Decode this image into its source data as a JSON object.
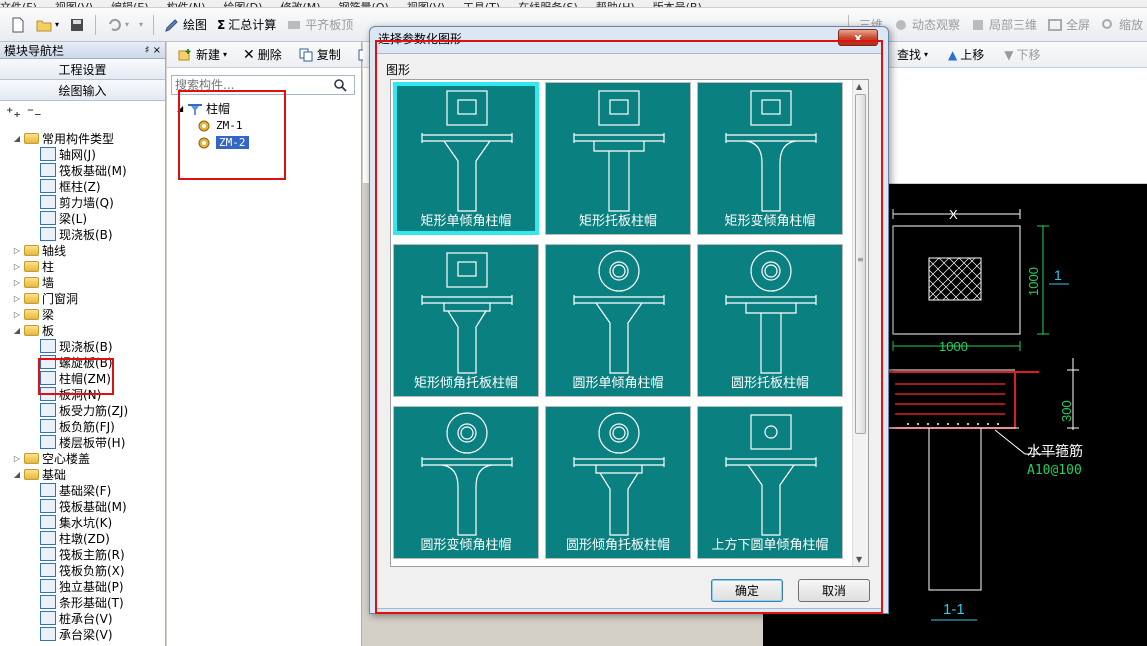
{
  "menubar": [
    "文件(F)",
    "视图(V)",
    "编辑(E)",
    "构件(N)",
    "绘图(D)",
    "修改(M)",
    "钢筋量(Q)",
    "视图(V)",
    "工具(T)",
    "在线服务(S)",
    "帮助(H)",
    "版本号(B)"
  ],
  "toolbar": {
    "draw": "绘图",
    "calc": "汇总计算",
    "align_slab": "平齐板顶",
    "view_3d": "三维",
    "dynamic_view": "动态观察",
    "local_3d": "局部三维",
    "fullscreen": "全屏",
    "zoom": "缩放"
  },
  "nav": {
    "title": "模块导航栏",
    "pin": "♯ ×",
    "btn_project": "工程设置",
    "btn_drawing": "绘图输入",
    "tree": [
      {
        "level": 0,
        "expand": "◢",
        "folder": true,
        "label": "常用构件类型"
      },
      {
        "level": 1,
        "label": "轴网(J)"
      },
      {
        "level": 1,
        "label": "筏板基础(M)"
      },
      {
        "level": 1,
        "label": "框柱(Z)"
      },
      {
        "level": 1,
        "label": "剪力墙(Q)"
      },
      {
        "level": 1,
        "label": "梁(L)"
      },
      {
        "level": 1,
        "label": "现浇板(B)"
      },
      {
        "level": 0,
        "expand": "▷",
        "folder": true,
        "label": "轴线"
      },
      {
        "level": 0,
        "expand": "▷",
        "folder": true,
        "label": "柱"
      },
      {
        "level": 0,
        "expand": "▷",
        "folder": true,
        "label": "墙"
      },
      {
        "level": 0,
        "expand": "▷",
        "folder": true,
        "label": "门窗洞"
      },
      {
        "level": 0,
        "expand": "▷",
        "folder": true,
        "label": "梁"
      },
      {
        "level": 0,
        "expand": "◢",
        "folder": true,
        "label": "板"
      },
      {
        "level": 1,
        "label": "现浇板(B)"
      },
      {
        "level": 1,
        "label": "螺旋板(B)"
      },
      {
        "level": 1,
        "label": "柱帽(ZM)"
      },
      {
        "level": 1,
        "label": "板洞(N)"
      },
      {
        "level": 1,
        "label": "板受力筋(ZJ)"
      },
      {
        "level": 1,
        "label": "板负筋(FJ)"
      },
      {
        "level": 1,
        "label": "楼层板带(H)"
      },
      {
        "level": 0,
        "expand": "▷",
        "folder": true,
        "label": "空心楼盖"
      },
      {
        "level": 0,
        "expand": "◢",
        "folder": true,
        "label": "基础"
      },
      {
        "level": 1,
        "label": "基础梁(F)"
      },
      {
        "level": 1,
        "label": "筏板基础(M)"
      },
      {
        "level": 1,
        "label": "集水坑(K)"
      },
      {
        "level": 1,
        "label": "柱墩(ZD)"
      },
      {
        "level": 1,
        "label": "筏板主筋(R)"
      },
      {
        "level": 1,
        "label": "筏板负筋(X)"
      },
      {
        "level": 1,
        "label": "独立基础(P)"
      },
      {
        "level": 1,
        "label": "条形基础(T)"
      },
      {
        "level": 1,
        "label": "桩承台(V)"
      },
      {
        "level": 1,
        "label": "承台梁(V)"
      }
    ]
  },
  "comp": {
    "new": "新建",
    "delete": "删除",
    "copy": "复制",
    "rename": "重",
    "search_placeholder": "搜索构件...",
    "root": "柱帽",
    "items": [
      "ZM-1",
      "ZM-2"
    ],
    "selected": "ZM-2"
  },
  "right_toolbar": {
    "find": "查找",
    "up": "上移",
    "down": "下移"
  },
  "cad": {
    "dim_x": "X",
    "dim_1000_h": "1000",
    "dim_1000_v": "1000",
    "section_ref": "1",
    "dim_300": "300",
    "annot_stirrup": "水平箍筋",
    "annot_rebar": "A10@100",
    "section_label": "1-1"
  },
  "dialog": {
    "title": "选择参数化图形",
    "close": "x",
    "group_label": "图形",
    "ok": "确定",
    "cancel": "取消",
    "tiles": [
      {
        "label": "矩形单倾角柱帽",
        "top": "rect",
        "base": "taper",
        "selected": true
      },
      {
        "label": "矩形托板柱帽",
        "top": "rect",
        "base": "plate"
      },
      {
        "label": "矩形变倾角柱帽",
        "top": "rect",
        "base": "curve"
      },
      {
        "label": "矩形倾角托板柱帽",
        "top": "rect",
        "base": "taperplate"
      },
      {
        "label": "圆形单倾角柱帽",
        "top": "circle",
        "base": "taper"
      },
      {
        "label": "圆形托板柱帽",
        "top": "circle",
        "base": "plate"
      },
      {
        "label": "圆形变倾角柱帽",
        "top": "circle",
        "base": "curve"
      },
      {
        "label": "圆形倾角托板柱帽",
        "top": "circle",
        "base": "taperplate"
      },
      {
        "label": "上方下圆单倾角柱帽",
        "top": "rectcircle",
        "base": "taper"
      }
    ]
  },
  "colors": {
    "tile_bg": "#0a8080",
    "tile_selected_border": "#33e7ef",
    "highlight_red": "#e01010",
    "cad_bg": "#000000"
  }
}
